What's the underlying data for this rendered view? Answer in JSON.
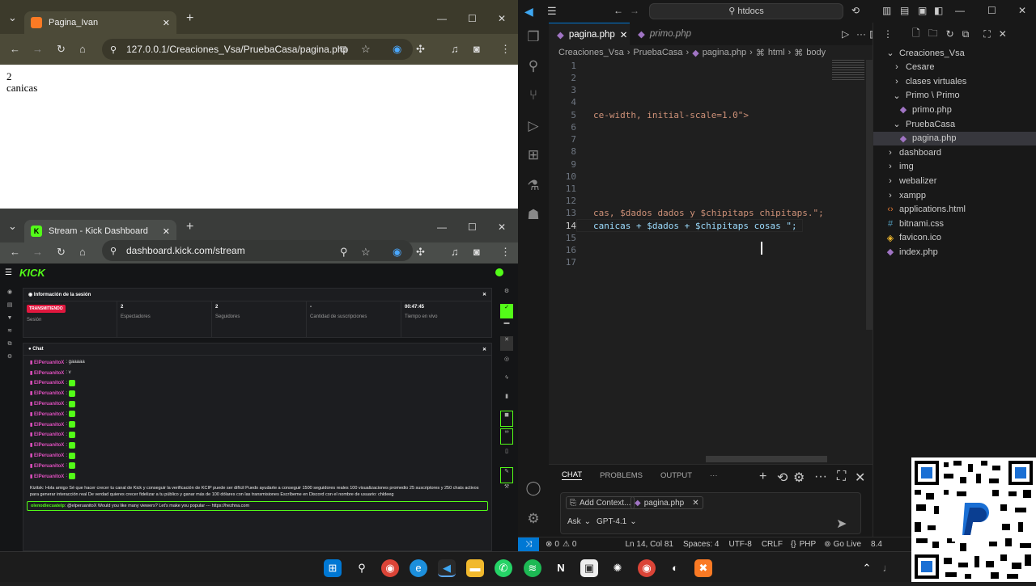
{
  "browser1": {
    "tab_title": "Pagina_Ivan",
    "url": "127.0.0.1/Creaciones_Vsa/PruebaCasa/pagina.php",
    "content_lines": [
      "2",
      "canicas"
    ]
  },
  "browser2": {
    "tab_title": "Stream - Kick Dashboard",
    "url": "dashboard.kick.com/stream"
  },
  "kick": {
    "logo": "KICK",
    "session_title": "Información de la sesión",
    "status_badge": "TRANSMITIENDO",
    "stats": [
      {
        "value": "",
        "label": "Sesión"
      },
      {
        "value": "2",
        "label": "Espectadores"
      },
      {
        "value": "2",
        "label": "Seguidores"
      },
      {
        "value": "-",
        "label": "Cantidad de suscripciones"
      },
      {
        "value": "00:47:45",
        "label": "Tiempo en vivo"
      }
    ],
    "chat_title": "Chat",
    "chat_lines": [
      ": gaaaaa",
      ": v",
      ":",
      ":",
      ":",
      ":",
      ":",
      ":",
      ":",
      ":",
      ":",
      ":"
    ],
    "spam_text": "Kizitsk: Hola amigo Sé que hacer crecer tu canal de Kick y conseguir la verificación de KCIP puede ser difícil Puedo ayudarte a conseguir 1500 seguidores reales 100 visualizaciones promedio 25 suscriptores y 250 chats activos para generar interacción real De verdad quieres crecer fidelizar a tu público y ganar más de 100 dólares con las transmisiones Escríbeme en Discord con el nombre de usuario: chldeeg",
    "highlight_user": "olenodiecuatelp",
    "highlight_text": "@elperuanitoX Would you like many viewers? Let's make you popular --- https://hezhna.com"
  },
  "vscode": {
    "search": "htdocs",
    "tabs": [
      {
        "label": "pagina.php",
        "active": true
      },
      {
        "label": "primo.php",
        "active": false
      }
    ],
    "breadcrumb": [
      "Creaciones_Vsa",
      "PruebaCasa",
      "pagina.php",
      "html",
      "body"
    ],
    "lines": [
      "1",
      "2",
      "3",
      "4",
      "5",
      "6",
      "7",
      "8",
      "9",
      "10",
      "11",
      "12",
      "13",
      "14",
      "15",
      "16",
      "17"
    ],
    "code": {
      "l5": "ce-width, initial-scale=1.0\">",
      "l13": "cas, $dados dados y $chipitaps chipitaps.\";",
      "l14": "canicas + $dados + $chipitaps cosas \";"
    },
    "explorer": [
      {
        "label": "Creaciones_Vsa",
        "depth": 0,
        "type": "folder-open"
      },
      {
        "label": "Cesare",
        "depth": 1,
        "type": "folder"
      },
      {
        "label": "clases virtuales",
        "depth": 1,
        "type": "folder"
      },
      {
        "label": "Primo \\ Primo",
        "depth": 1,
        "type": "folder-open"
      },
      {
        "label": "primo.php",
        "depth": 2,
        "type": "php"
      },
      {
        "label": "PruebaCasa",
        "depth": 1,
        "type": "folder-open"
      },
      {
        "label": "pagina.php",
        "depth": 2,
        "type": "php",
        "selected": true
      },
      {
        "label": "dashboard",
        "depth": 0,
        "type": "folder"
      },
      {
        "label": "img",
        "depth": 0,
        "type": "folder"
      },
      {
        "label": "webalizer",
        "depth": 0,
        "type": "folder"
      },
      {
        "label": "xampp",
        "depth": 0,
        "type": "folder"
      },
      {
        "label": "applications.html",
        "depth": 0,
        "type": "html"
      },
      {
        "label": "bitnami.css",
        "depth": 0,
        "type": "css"
      },
      {
        "label": "favicon.ico",
        "depth": 0,
        "type": "ico"
      },
      {
        "label": "index.php",
        "depth": 0,
        "type": "php"
      }
    ],
    "panel_tabs": [
      "CHAT",
      "PROBLEMS",
      "OUTPUT",
      "···"
    ],
    "chat": {
      "add_context": "Add Context...",
      "file_chip": "pagina.php",
      "mode": "Ask",
      "model": "GPT-4.1"
    },
    "status": {
      "errors": "0",
      "warnings": "0",
      "position": "Ln 14, Col 81",
      "spaces": "Spaces: 4",
      "encoding": "UTF-8",
      "eol": "CRLF",
      "lang": "PHP",
      "golive": "Go Live",
      "extra": "8.4"
    }
  },
  "colors": {
    "kick_green": "#53fc18",
    "vs_blue": "#0078d4",
    "php_purple": "#a074c4"
  }
}
